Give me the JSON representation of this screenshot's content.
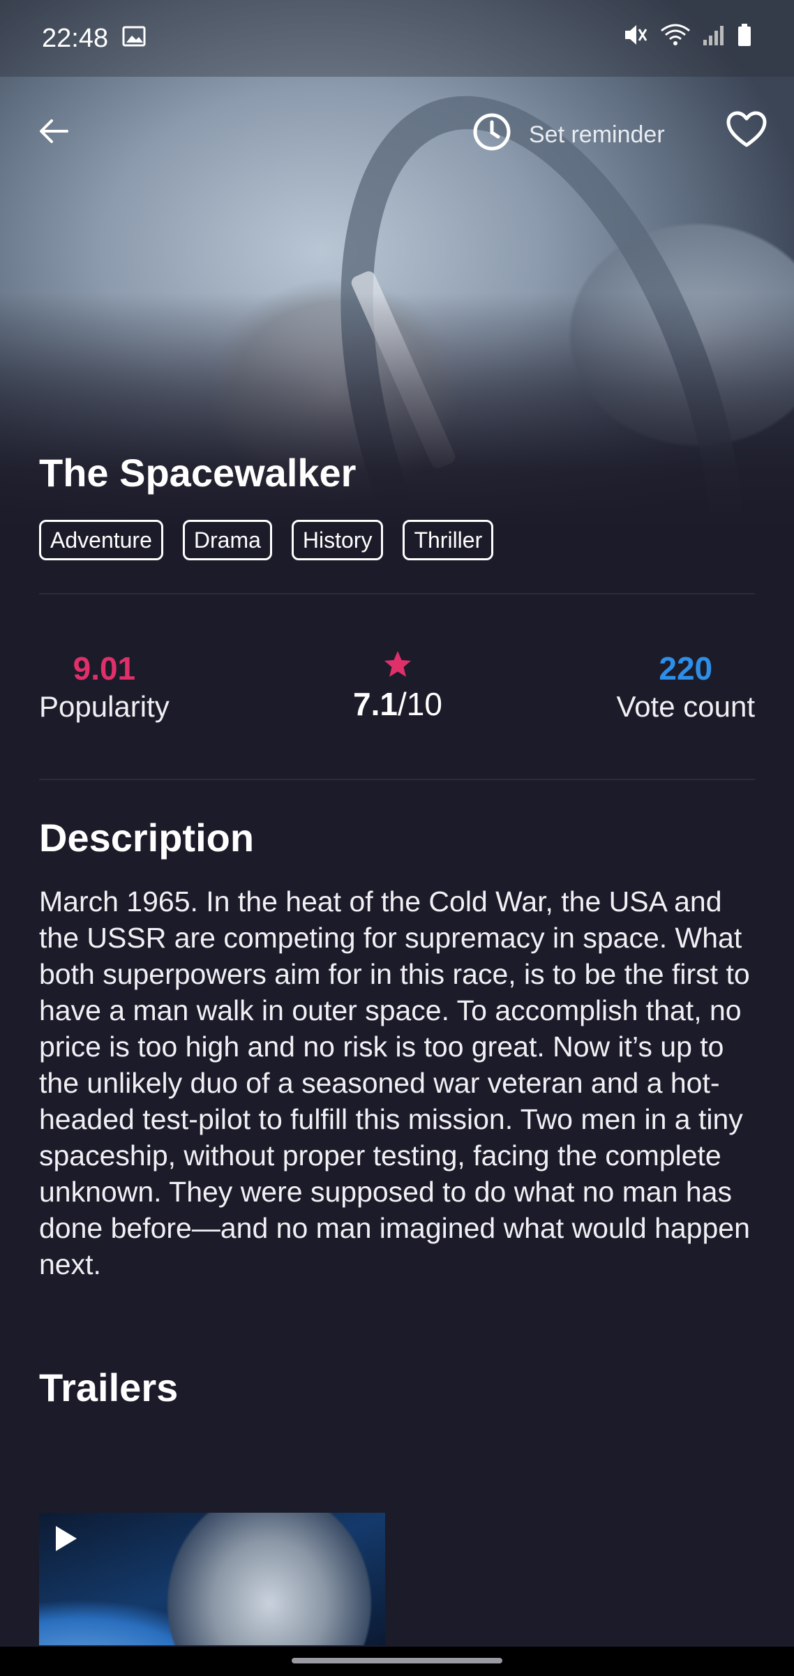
{
  "status_bar": {
    "time": "22:48"
  },
  "app_bar": {
    "reminder_label": "Set reminder"
  },
  "movie": {
    "title": "The Spacewalker",
    "genres": [
      "Adventure",
      "Drama",
      "History",
      "Thriller"
    ],
    "popularity": "9.01",
    "popularity_label": "Popularity",
    "rating": "7.1",
    "rating_max": "/10",
    "vote_count": "220",
    "vote_count_label": "Vote count"
  },
  "description": {
    "heading": "Description",
    "text": "March 1965. In the heat of the Cold War, the USA and the USSR are competing for supremacy in space. What both superpowers aim for in this race, is to be the first to have a man walk in outer space. To accomplish that, no price is too high and no risk is too great. Now it’s up to the unlikely duo of a seasoned war veteran and a hot-headed test-pilot to fulfill this mission. Two men in a tiny spaceship, without proper testing, facing the complete unknown. They were supposed to do what no man has done before—and no man imagined what would happen next."
  },
  "trailers": {
    "heading": "Trailers"
  },
  "colors": {
    "background": "#1c1b29",
    "popularity": "#e0306a",
    "vote_count": "#2e8fe8",
    "star": "#e0306a"
  },
  "icons": {
    "back": "arrow-left-icon",
    "reminder": "clock-icon",
    "favorite": "heart-outline-icon",
    "rating": "star-icon",
    "play": "play-icon"
  }
}
